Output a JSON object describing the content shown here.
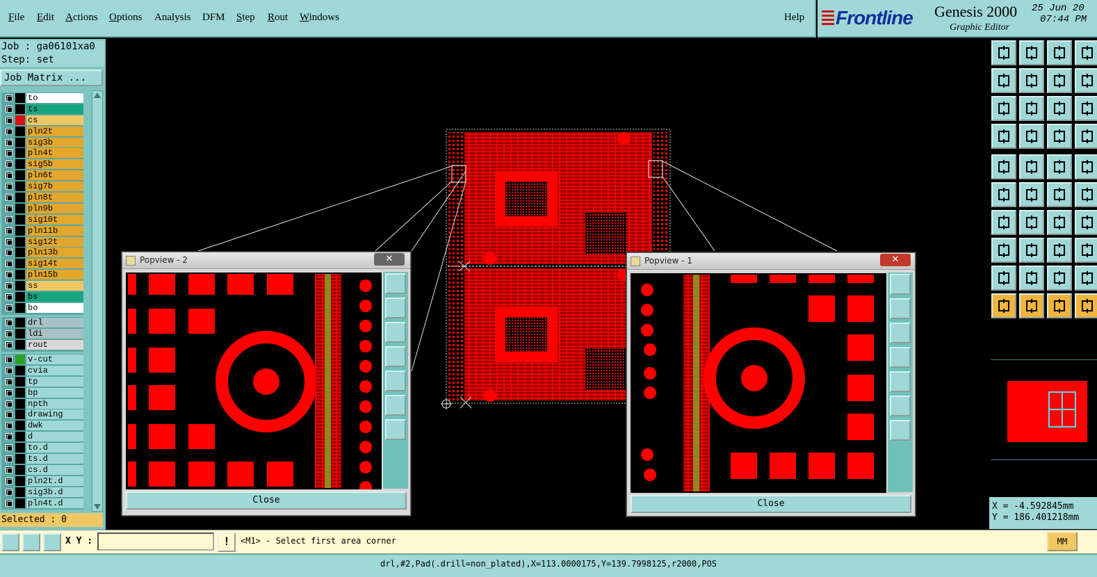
{
  "menu": {
    "items": [
      "File",
      "Edit",
      "Actions",
      "Options",
      "Analysis",
      "DFM",
      "Step",
      "Rout",
      "Windows"
    ],
    "help": "Help"
  },
  "brand": {
    "logo": "Frontline",
    "product": "Genesis 2000",
    "subtitle": "Graphic Editor",
    "date": "25 Jun 20",
    "time": "07:44 PM"
  },
  "job": {
    "job_line": "Job : ga06101xa0",
    "step_line": "Step: set",
    "matrix_button": "Job Matrix ..."
  },
  "layers": {
    "board": [
      {
        "name": "to",
        "color": "#ffffff",
        "swatch": "#000000"
      },
      {
        "name": "ts",
        "color": "#17a57f",
        "swatch": "#000000"
      },
      {
        "name": "cs",
        "color": "#f1c766",
        "swatch": "#e01010"
      },
      {
        "name": "pln2t",
        "color": "#e2a72d",
        "swatch": "#000000"
      },
      {
        "name": "sig3b",
        "color": "#e2a72d",
        "swatch": "#000000"
      },
      {
        "name": "pln4t",
        "color": "#e2a72d",
        "swatch": "#000000"
      },
      {
        "name": "sig5b",
        "color": "#e2a72d",
        "swatch": "#000000"
      },
      {
        "name": "pln6t",
        "color": "#e2a72d",
        "swatch": "#000000"
      },
      {
        "name": "sig7b",
        "color": "#e2a72d",
        "swatch": "#000000"
      },
      {
        "name": "pln8t",
        "color": "#e2a72d",
        "swatch": "#000000"
      },
      {
        "name": "pln9b",
        "color": "#e2a72d",
        "swatch": "#000000"
      },
      {
        "name": "sig10t",
        "color": "#e2a72d",
        "swatch": "#000000"
      },
      {
        "name": "pln11b",
        "color": "#e2a72d",
        "swatch": "#000000"
      },
      {
        "name": "sig12t",
        "color": "#e2a72d",
        "swatch": "#000000"
      },
      {
        "name": "pln13b",
        "color": "#e2a72d",
        "swatch": "#000000"
      },
      {
        "name": "sig14t",
        "color": "#e2a72d",
        "swatch": "#000000"
      },
      {
        "name": "pln15b",
        "color": "#e2a72d",
        "swatch": "#000000"
      },
      {
        "name": "ss",
        "color": "#f1c766",
        "swatch": "#000000"
      },
      {
        "name": "bs",
        "color": "#17a57f",
        "swatch": "#000000"
      },
      {
        "name": "bo",
        "color": "#ffffff",
        "swatch": "#000000"
      }
    ],
    "drill": [
      {
        "name": "drl",
        "color": "#a9c1c4",
        "swatch": "#000000"
      },
      {
        "name": "ldi",
        "color": "#a9c1c4",
        "swatch": "#000000"
      },
      {
        "name": "rout",
        "color": "#d8d8d8",
        "swatch": "#000000"
      }
    ],
    "misc": [
      {
        "name": "v-cut",
        "color": "#9fd8d6",
        "swatch": "#2aa02a"
      },
      {
        "name": "cvia",
        "color": "#9fd8d6",
        "swatch": "#000000"
      },
      {
        "name": "tp",
        "color": "#9fd8d6",
        "swatch": "#000000"
      },
      {
        "name": "bp",
        "color": "#9fd8d6",
        "swatch": "#000000"
      },
      {
        "name": "npth",
        "color": "#9fd8d6",
        "swatch": "#000000"
      },
      {
        "name": "drawing",
        "color": "#9fd8d6",
        "swatch": "#000000"
      },
      {
        "name": "dwk",
        "color": "#9fd8d6",
        "swatch": "#000000"
      },
      {
        "name": "d",
        "color": "#9fd8d6",
        "swatch": "#000000"
      },
      {
        "name": "to.d",
        "color": "#9fd8d6",
        "swatch": "#000000"
      },
      {
        "name": "ts.d",
        "color": "#9fd8d6",
        "swatch": "#000000"
      },
      {
        "name": "cs.d",
        "color": "#9fd8d6",
        "swatch": "#000000"
      },
      {
        "name": "pln2t.d",
        "color": "#9fd8d6",
        "swatch": "#000000"
      },
      {
        "name": "sig3b.d",
        "color": "#9fd8d6",
        "swatch": "#000000"
      },
      {
        "name": "pln4t.d",
        "color": "#9fd8d6",
        "swatch": "#000000"
      }
    ]
  },
  "selected": "Selected : 0",
  "popview2": {
    "title": "Popview - 2",
    "close_label": "Close"
  },
  "popview1": {
    "title": "Popview - 1",
    "close_label": "Close"
  },
  "coords": {
    "x": "X = -4.592845mm",
    "y": "Y = 186.401218mm"
  },
  "command": {
    "xy_label": "X Y :",
    "xy_value": "",
    "prompt": "<M1> - Select first area corner",
    "units": "MM"
  },
  "status": "drl,#2,Pad(.drill=non_plated),X=113.0000175,Y=139.7998125,r2000,POS",
  "colors": {
    "copper": "#ff0000",
    "background": "#000000",
    "panel": "#9fd8d6",
    "highlight": "#f1c766"
  }
}
